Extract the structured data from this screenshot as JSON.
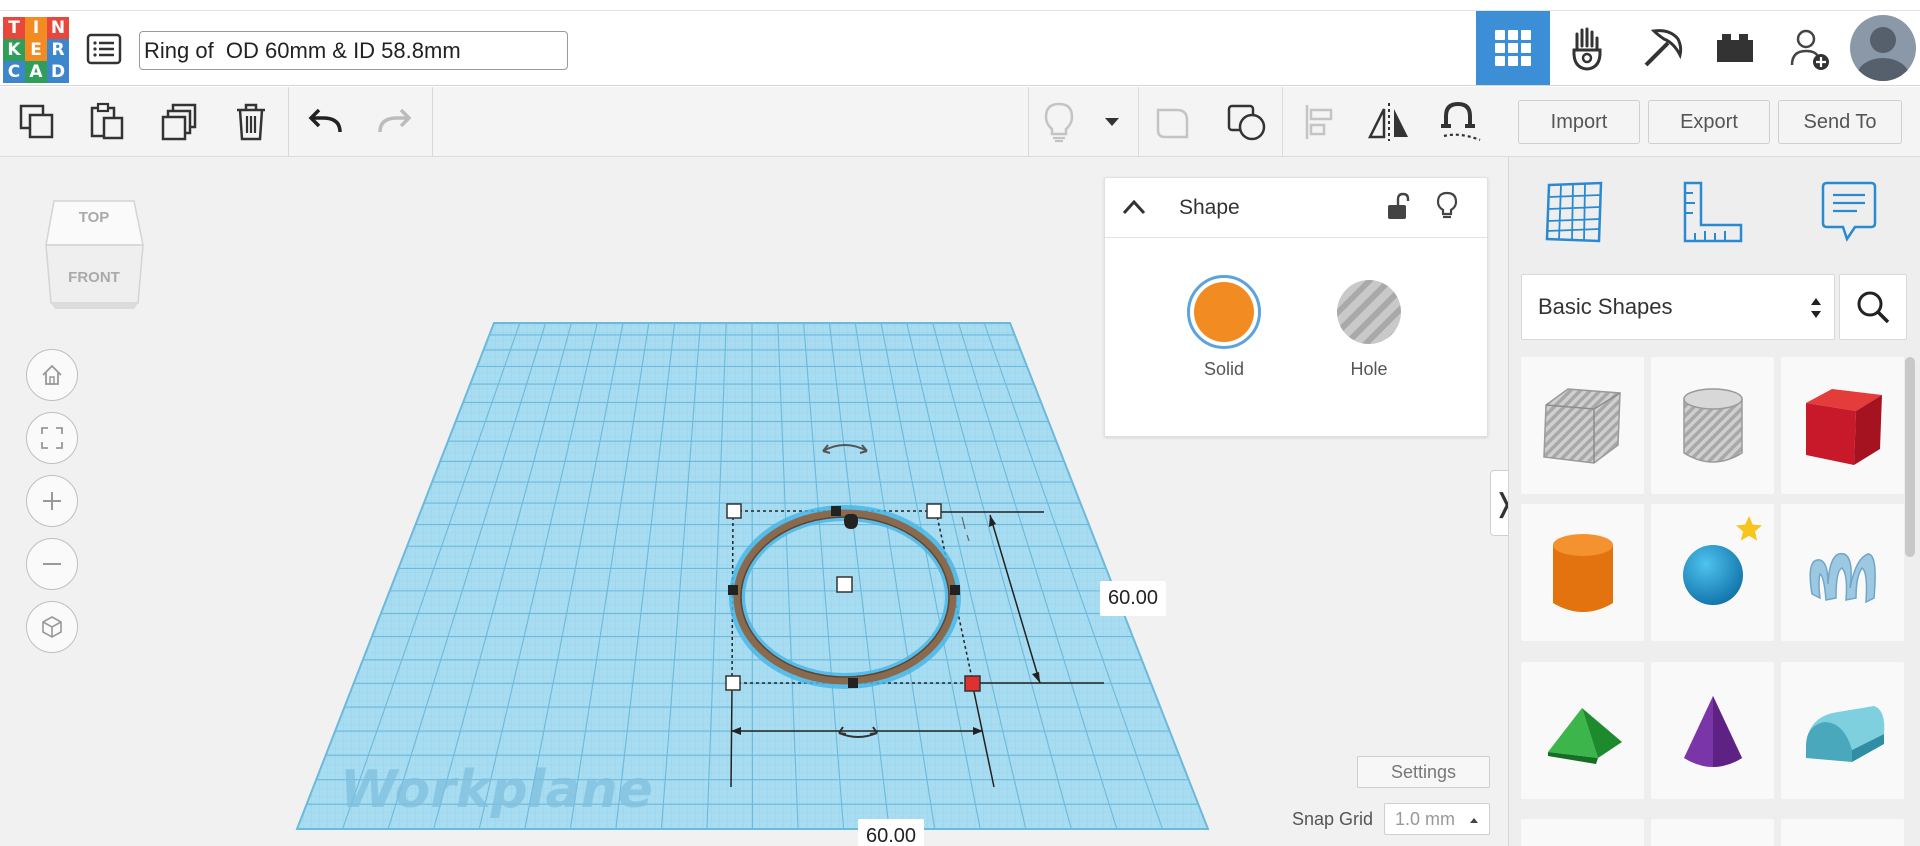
{
  "logo": {
    "letters": [
      "T",
      "I",
      "N",
      "K",
      "E",
      "R",
      "C",
      "A",
      "D"
    ],
    "colors": [
      "#e8473b",
      "#f28b22",
      "#e8473b",
      "#2f9e58",
      "#f28b22",
      "#3d86cc",
      "#3d86cc",
      "#2f9e58",
      "#3d86cc"
    ]
  },
  "design_title": "Ring of  OD 60mm & ID 58.8mm",
  "top_nav_icons": [
    "3d-view-grid-icon",
    "circuits-hand-icon",
    "minecraft-pickaxe-icon",
    "brick-icon",
    "add-user-icon",
    "user-avatar"
  ],
  "toolbar": {
    "tools": [
      "copy-icon",
      "paste-icon",
      "duplicate-icon",
      "delete-icon",
      "undo-icon",
      "redo-icon"
    ],
    "view_tools": [
      "show-all-icon",
      "dropdown-arrow-icon",
      "group-icon",
      "ungroup-icon",
      "align-icon",
      "mirror-icon",
      "workplane-magnet-icon"
    ],
    "import_label": "Import",
    "export_label": "Export",
    "send_to_label": "Send To"
  },
  "view_cube": {
    "top": "TOP",
    "front": "FRONT"
  },
  "nav_controls": [
    "home-icon",
    "fit-view-icon",
    "zoom-in-icon",
    "zoom-out-icon",
    "ortho-view-icon"
  ],
  "shape_panel": {
    "title": "Shape",
    "solid_label": "Solid",
    "hole_label": "Hole",
    "solid_color": "#f28b22"
  },
  "workplane": {
    "label": "Workplane",
    "dim_depth": "60.00",
    "dim_width": "60.00"
  },
  "bottom": {
    "settings_label": "Settings",
    "snap_grid_label": "Snap Grid",
    "snap_grid_value": "1.0 mm"
  },
  "sidebar": {
    "top_icons": [
      "workplane-grid-icon",
      "ruler-icon",
      "notes-icon"
    ],
    "category": "Basic Shapes",
    "shapes": [
      "box-hole",
      "cylinder-hole",
      "box",
      "cylinder",
      "sphere",
      "scribble",
      "roof",
      "cone",
      "round-roof"
    ]
  }
}
